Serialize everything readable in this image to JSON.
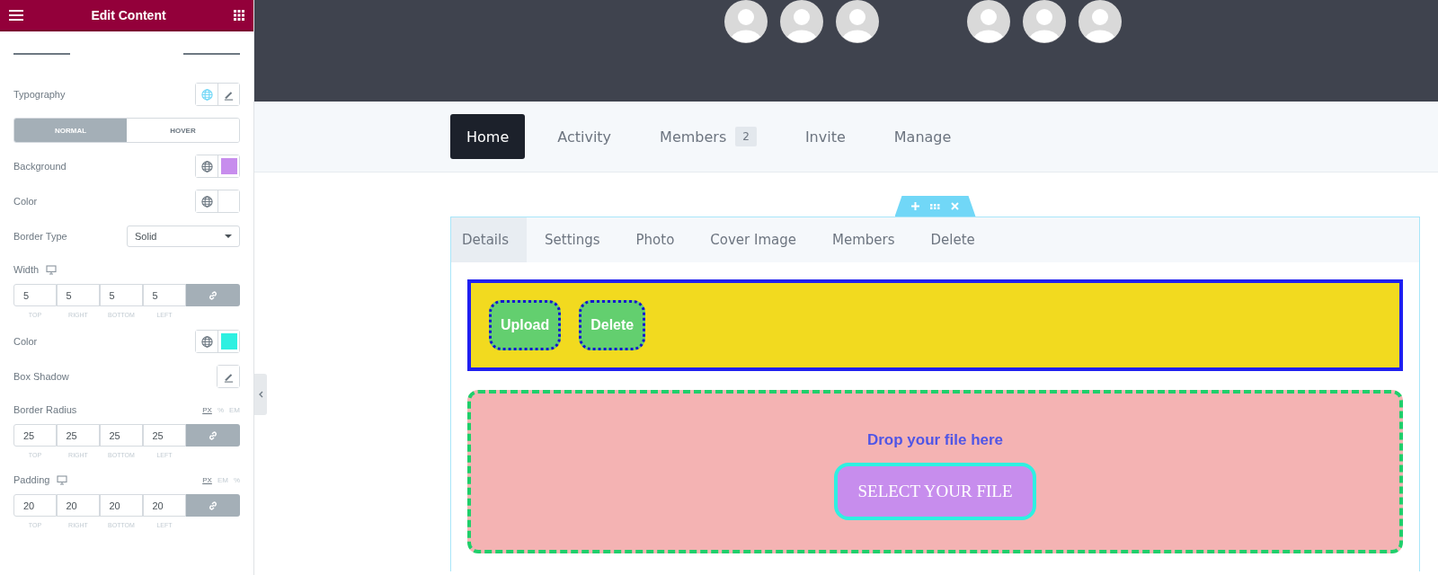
{
  "panel": {
    "title": "Edit Content",
    "controls": [
      {
        "kind": "popover",
        "label": "Typography",
        "global": true,
        "global_active": true
      },
      {
        "kind": "toggle",
        "options": [
          {
            "label": "NORMAL",
            "selected": true
          },
          {
            "label": "HOVER",
            "selected": false
          }
        ]
      },
      {
        "kind": "color",
        "label": "Background",
        "global": true,
        "global_active": false,
        "color": "#c78ded"
      },
      {
        "kind": "color",
        "label": "Color",
        "global": true,
        "global_active": false
      },
      {
        "kind": "select",
        "label": "Border Type",
        "value": "Solid"
      },
      {
        "kind": "dimensions",
        "label": "Width",
        "responsive": true,
        "linked": true,
        "values": [
          "5",
          "5",
          "5",
          "5"
        ],
        "sides": [
          "TOP",
          "RIGHT",
          "BOTTOM",
          "LEFT"
        ]
      },
      {
        "kind": "color",
        "label": "Color",
        "global": true,
        "global_active": false,
        "color": "#2ef0e1"
      },
      {
        "kind": "popover",
        "label": "Box Shadow",
        "global": false
      },
      {
        "kind": "dimensions",
        "label": "Border Radius",
        "responsive": false,
        "linked": true,
        "units": [
          {
            "label": "PX",
            "selected": true
          },
          {
            "label": "%",
            "selected": false
          },
          {
            "label": "EM",
            "selected": false
          }
        ],
        "values": [
          "25",
          "25",
          "25",
          "25"
        ],
        "sides": [
          "TOP",
          "RIGHT",
          "BOTTOM",
          "LEFT"
        ]
      },
      {
        "kind": "dimensions",
        "label": "Padding",
        "responsive": true,
        "linked": true,
        "units": [
          {
            "label": "PX",
            "selected": true
          },
          {
            "label": "EM",
            "selected": false
          },
          {
            "label": "%",
            "selected": false
          }
        ],
        "values": [
          "20",
          "20",
          "20",
          "20"
        ],
        "sides": [
          "TOP",
          "RIGHT",
          "BOTTOM",
          "LEFT"
        ]
      }
    ]
  },
  "header": {
    "avatar_groups": [
      [
        {
          "kind": "avatar"
        },
        {
          "kind": "avatar"
        },
        {
          "kind": "avatar"
        }
      ],
      [
        {
          "kind": "avatar"
        },
        {
          "kind": "avatar"
        },
        {
          "kind": "avatar"
        }
      ]
    ]
  },
  "nav": [
    {
      "label": "Home",
      "selected": true
    },
    {
      "label": "Activity",
      "selected": false
    },
    {
      "label": "Members",
      "badge": "2",
      "selected": false
    },
    {
      "label": "Invite",
      "selected": false
    },
    {
      "label": "Manage",
      "selected": false
    }
  ],
  "subtabs": [
    {
      "label": "Details",
      "selected": true
    },
    {
      "label": "Settings",
      "selected": false
    },
    {
      "label": "Photo",
      "selected": false
    },
    {
      "label": "Cover Image",
      "selected": false
    },
    {
      "label": "Members",
      "selected": false
    },
    {
      "label": "Delete",
      "selected": false
    }
  ],
  "actions": [
    "Upload",
    "Delete"
  ],
  "dropzone": {
    "message": "Drop your file here",
    "button": "SELECT YOUR FILE"
  }
}
